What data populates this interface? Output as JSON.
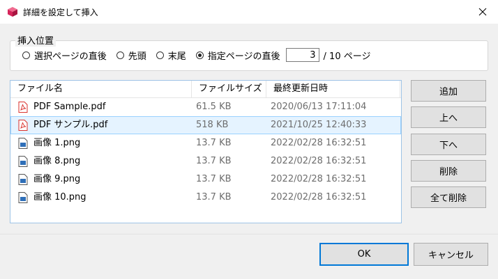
{
  "window": {
    "title": "詳細を設定して挿入",
    "app_icon": "cube-app-icon",
    "close_icon": "close-icon"
  },
  "insert_position": {
    "legend": "挿入位置",
    "options": [
      {
        "label": "選択ページの直後",
        "checked": false
      },
      {
        "label": "先頭",
        "checked": false
      },
      {
        "label": "末尾",
        "checked": false
      },
      {
        "label": "指定ページの直後",
        "checked": true
      }
    ],
    "page_value": "3",
    "page_suffix": "/ 10 ページ"
  },
  "file_list": {
    "columns": [
      "ファイル名",
      "ファイルサイズ",
      "最終更新日時"
    ],
    "rows": [
      {
        "name": "PDF Sample.pdf",
        "size": "61.5 KB",
        "date": "2020/06/13 17:11:04",
        "icon": "pdf-file-icon",
        "selected": false
      },
      {
        "name": "PDF サンプル.pdf",
        "size": "518 KB",
        "date": "2021/10/25 12:40:33",
        "icon": "pdf-file-icon",
        "selected": true
      },
      {
        "name": "画像 1.png",
        "size": "13.7 KB",
        "date": "2022/02/28 16:32:51",
        "icon": "image-file-icon",
        "selected": false
      },
      {
        "name": "画像 8.png",
        "size": "13.7 KB",
        "date": "2022/02/28 16:32:51",
        "icon": "image-file-icon",
        "selected": false
      },
      {
        "name": "画像 9.png",
        "size": "13.7 KB",
        "date": "2022/02/28 16:32:51",
        "icon": "image-file-icon",
        "selected": false
      },
      {
        "name": "画像 10.png",
        "size": "13.7 KB",
        "date": "2022/02/28 16:32:51",
        "icon": "image-file-icon",
        "selected": false
      }
    ]
  },
  "side_buttons": {
    "add": "追加",
    "up": "上へ",
    "down": "下へ",
    "delete": "削除",
    "delete_all": "全て削除"
  },
  "footer": {
    "ok": "OK",
    "cancel": "キャンセル"
  },
  "colors": {
    "accent": "#0078d7",
    "selection_bg": "#e5f3ff",
    "selection_border": "#99d1ff",
    "pdf_red": "#d9322e",
    "image_blue": "#2f6fb8"
  }
}
